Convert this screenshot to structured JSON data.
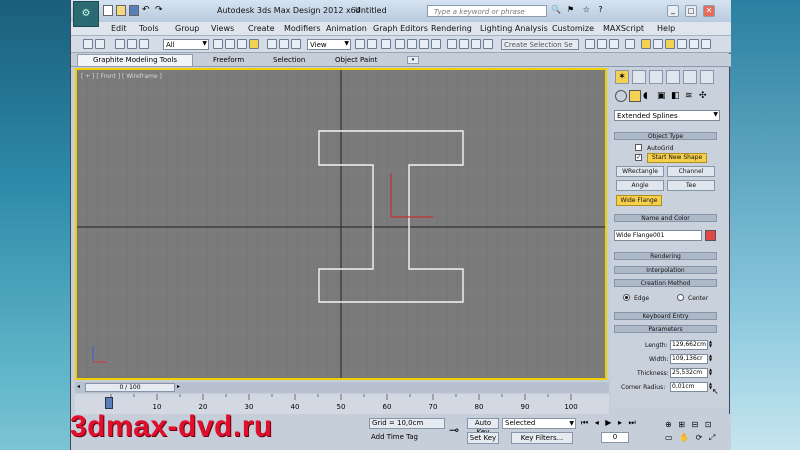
{
  "window": {
    "title": "Autodesk 3ds Max Design 2012 x64",
    "doc": "Untitled",
    "search_placeholder": "Type a keyword or phrase"
  },
  "menu": [
    "Edit",
    "Tools",
    "Group",
    "Views",
    "Create",
    "Modifiers",
    "Animation",
    "Graph Editors",
    "Rendering",
    "Lighting Analysis",
    "Customize",
    "MAXScript",
    "Help"
  ],
  "toolbar": {
    "filter": "All",
    "coord": "View",
    "selection_set": "Create Selection Se"
  },
  "ribbon": {
    "tabs": [
      "Graphite Modeling Tools",
      "Freeform",
      "Selection",
      "Object Paint"
    ]
  },
  "viewport": {
    "label": "[ + ] [ Front ] [ Wireframe ]"
  },
  "panel": {
    "category": "Extended Splines",
    "object_type": {
      "title": "Object Type",
      "autogrid": "AutoGrid",
      "start_new_shape": "Start New Shape",
      "buttons": [
        "WRectangle",
        "Channel",
        "Angle",
        "Tee",
        "Wide Flange"
      ]
    },
    "name_color": {
      "title": "Name and Color",
      "name": "Wide Flange001",
      "color": "#e04848"
    },
    "rollouts": {
      "rendering": "Rendering",
      "interpolation": "Interpolation",
      "creation_method": "Creation Method",
      "keyboard": "Keyboard Entry",
      "parameters": "Parameters"
    },
    "creation": {
      "edge": "Edge",
      "center": "Center"
    },
    "params": {
      "length_label": "Length:",
      "length": "129,662cm",
      "width_label": "Width:",
      "width": "109,136cr",
      "thickness_label": "Thickness:",
      "thickness": "25,532cm",
      "corner_label": "Corner Radius:",
      "corner": "0,01cm"
    }
  },
  "time": {
    "slider": "0 / 100",
    "ticks": [
      "0",
      "10",
      "20",
      "30",
      "40",
      "50",
      "60",
      "70",
      "80",
      "90",
      "100"
    ],
    "frame": "0"
  },
  "status": {
    "grid": "Grid = 10,0cm",
    "add_time_tag": "Add Time Tag",
    "auto_key": "Auto Key",
    "selected": "Selected",
    "set_key": "Set Key",
    "key_filters": "Key Filters..."
  },
  "watermark": "3dmax-dvd.ru"
}
